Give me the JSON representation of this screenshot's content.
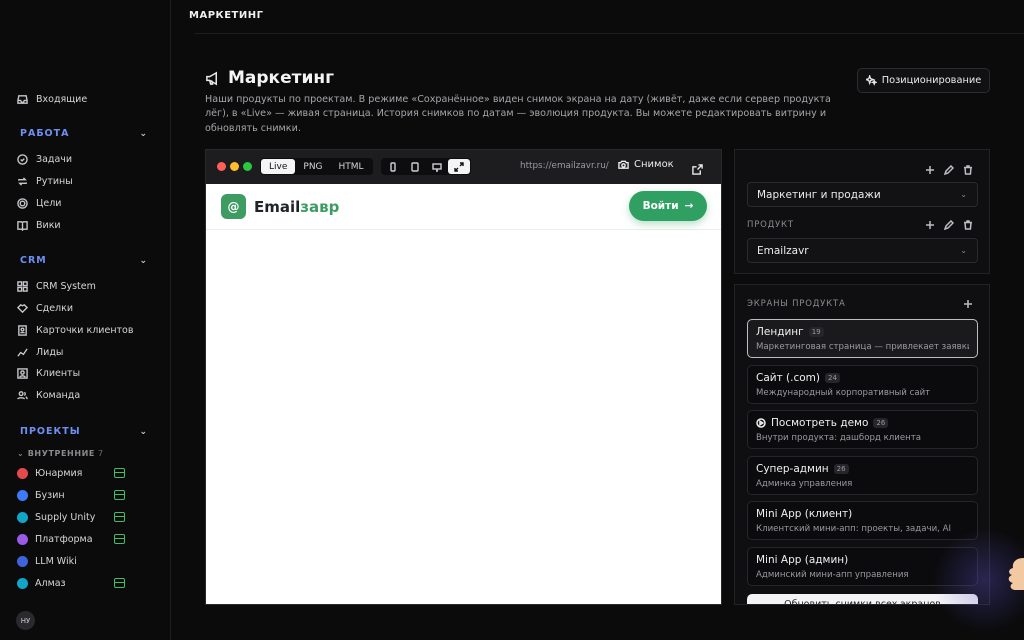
{
  "topbar": {
    "crumb": "МАРКЕТИНГ"
  },
  "sidebar": {
    "inbox": "Входящие",
    "sections": {
      "work": "РАБОТА",
      "crm": "CRM",
      "projects": "ПРОЕКТЫ"
    },
    "work_items": [
      "Задачи",
      "Рутины",
      "Цели",
      "Вики"
    ],
    "crm_items": [
      "CRM System",
      "Сделки",
      "Карточки клиентов",
      "Лиды",
      "Клиенты",
      "Команда"
    ],
    "internal_label": "ВНУТРЕННИЕ",
    "internal_count": "7",
    "projects": [
      {
        "name": "Юнармия",
        "color": "#e5484d",
        "server": true
      },
      {
        "name": "Бузин",
        "color": "#3e7bfa",
        "server": true
      },
      {
        "name": "Supply Unity",
        "color": "#12a5c7",
        "server": true
      },
      {
        "name": "Платформа",
        "color": "#9b59e8",
        "server": true
      },
      {
        "name": "LLM Wiki",
        "color": "#3e63dd",
        "server": false
      },
      {
        "name": "Алмаз",
        "color": "#12a5c7",
        "server": true
      }
    ],
    "avatar": "НУ"
  },
  "header": {
    "title": "Маркетинг",
    "description": "Наши продукты по проектам. В режиме «Сохранённое» виден снимок экрана на дату (живёт, даже если сервер продукта лёг), в «Live» — живая страница. История снимков по датам — эволюция продукта. Вы можете редактировать витрину и обновлять снимки.",
    "positioning_button": "Позиционирование"
  },
  "preview": {
    "modes": [
      "Live",
      "PNG",
      "HTML"
    ],
    "active_mode": "Live",
    "url": "https://emailzavr.ru/",
    "snapshot_label": "Снимок",
    "site": {
      "logo_mark": "@",
      "logo_part1": "Email",
      "logo_part2": "завр",
      "login_button": "Войти",
      "login_arrow": "→"
    }
  },
  "panel": {
    "direction_select": "Маркетинг и продажи",
    "product_label": "ПРОДУКТ",
    "product_select": "Emailzavr",
    "screens_label": "ЭКРАНЫ ПРОДУКТА",
    "screens": [
      {
        "title": "Лендинг",
        "count": "19",
        "subtitle": "Маркетинговая страница — привлекает заявки",
        "selected": true,
        "play": false
      },
      {
        "title": "Сайт (.com)",
        "count": "24",
        "subtitle": "Международный корпоративный сайт",
        "selected": false,
        "play": false
      },
      {
        "title": "Посмотреть демо",
        "count": "26",
        "subtitle": "Внутри продукта: дашборд клиента",
        "selected": false,
        "play": true
      },
      {
        "title": "Супер-админ",
        "count": "26",
        "subtitle": "Админка управления",
        "selected": false,
        "play": false
      },
      {
        "title": "Mini App (клиент)",
        "count": "",
        "subtitle": "Клиентский мини-апп: проекты, задачи, AI",
        "selected": false,
        "play": false
      },
      {
        "title": "Mini App (админ)",
        "count": "",
        "subtitle": "Админский мини-апп управления",
        "selected": false,
        "play": false
      }
    ],
    "refresh_button": "Обновить снимки всех экранов"
  },
  "colors": {
    "accent": "#6f8ff5",
    "brand_green": "#2fa061",
    "background": "#0b0b0c"
  }
}
